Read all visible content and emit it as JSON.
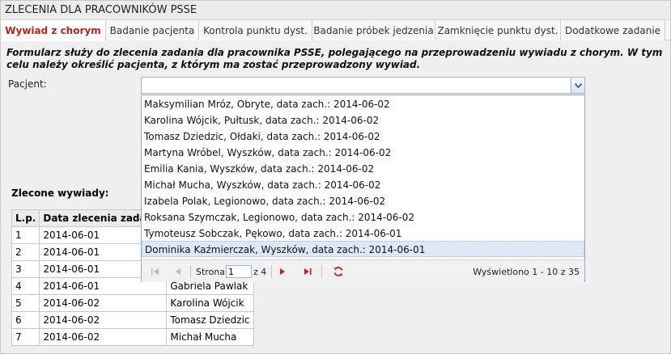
{
  "panel": {
    "title": "ZLECENIA DLA PRACOWNIKÓW PSSE"
  },
  "tabs": [
    {
      "label": "Wywiad z chorym"
    },
    {
      "label": "Badanie pacjenta"
    },
    {
      "label": "Kontrola punktu dyst."
    },
    {
      "label": "Badanie próbek jedzenia"
    },
    {
      "label": "Zamknięcie punktu dyst."
    },
    {
      "label": "Dodatkowe zadanie"
    }
  ],
  "form": {
    "description": "Formularz służy do zlecenia zadania dla pracownika PSSE, polegającego na przeprowadzeniu wywiadu z chorym. W tym celu należy określić pacjenta, z którym ma zostać przeprowadzony wywiad.",
    "patient_label": "Pacjent:",
    "patient_value": ""
  },
  "dropdown": {
    "items": [
      "Maksymilian Mróz, Obryte, data zach.: 2014-06-02",
      "Karolina Wójcik, Pułtusk, data zach.: 2014-06-02",
      "Tomasz Dziedzic, Ołdaki, data zach.: 2014-06-02",
      "Martyna Wróbel, Wyszków, data zach.: 2014-06-02",
      "Emilia Kania, Wyszków, data zach.: 2014-06-02",
      "Michał Mucha, Wyszków, data zach.: 2014-06-02",
      "Izabela Polak, Legionowo, data zach.: 2014-06-02",
      "Roksana Szymczak, Legionowo, data zach.: 2014-06-02",
      "Tymoteusz Sobczak, Pękowo, data zach.: 2014-06-01",
      "Dominika Kaźmierczak, Wyszków, data zach.: 2014-06-01"
    ],
    "selected_index": 9,
    "pager": {
      "page_label": "Strona",
      "page_value": "1",
      "of_label": "z 4",
      "summary": "Wyświetlono 1 - 10 z 35"
    }
  },
  "orders": {
    "title": "Zlecone wywiady:",
    "columns": [
      "L.p.",
      "Data zlecenia zadania",
      ""
    ],
    "rows": [
      [
        "1",
        "2014-06-01",
        ""
      ],
      [
        "2",
        "2014-06-01",
        ""
      ],
      [
        "3",
        "2014-06-01",
        ""
      ],
      [
        "4",
        "2014-06-01",
        "Gabriela Pawlak"
      ],
      [
        "5",
        "2014-06-02",
        "Karolina Wójcik"
      ],
      [
        "6",
        "2014-06-02",
        "Tomasz Dziedzic"
      ],
      [
        "7",
        "2014-06-02",
        "Michał Mucha"
      ]
    ]
  },
  "icons": {
    "combo_trigger": "chevron-down-icon",
    "first_page": "first-page-icon",
    "prev_page": "prev-page-icon",
    "next_page": "next-page-icon",
    "last_page": "last-page-icon",
    "refresh": "refresh-icon"
  },
  "colors": {
    "active_tab": "#b3261e",
    "accent_red": "#cc1b1b"
  }
}
